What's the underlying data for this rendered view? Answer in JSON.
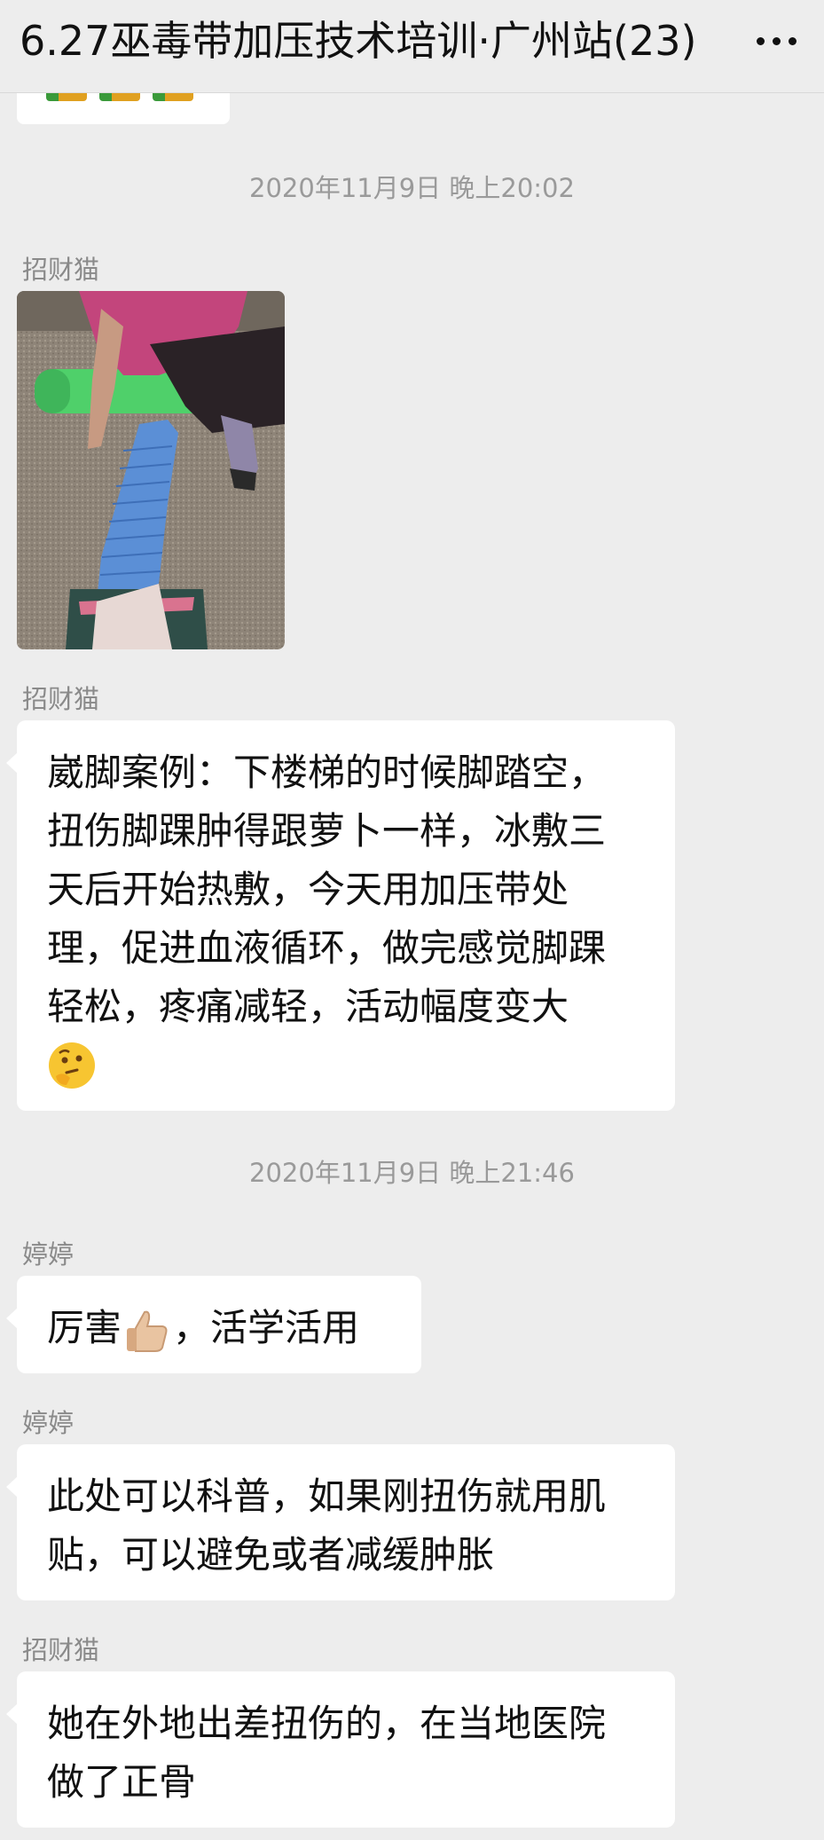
{
  "header": {
    "title": "6.27巫毒带加压技术培训·广州站(23)",
    "more_icon": "more-dots-icon"
  },
  "messages": {
    "ts1": "2020年11月9日 晚上20:02",
    "m1": {
      "sender": "招财猫"
    },
    "m2": {
      "sender": "招财猫",
      "lines": [
        "崴脚案例：下楼梯的时候脚踏空，",
        "扭伤脚踝肿得跟萝卜一样，冰敷三",
        "天后开始热敷，今天用加压带处",
        "理，促进血液循环，做完感觉脚踝",
        "轻松，疼痛减轻，活动幅度变大"
      ],
      "emoji": "thinking-face-icon"
    },
    "ts2": "2020年11月9日 晚上21:46",
    "m3": {
      "sender": "婷婷",
      "text_a": "厉害",
      "emoji": "thumbs-up-icon",
      "text_b": "，活学活用"
    },
    "m4": {
      "sender": "婷婷",
      "lines": [
        "此处可以科普，如果刚扭伤就用肌",
        "贴，可以避免或者减缓肿胀"
      ]
    },
    "m5": {
      "sender": "招财猫",
      "lines": [
        "她在外地出差扭伤的，在当地医院",
        "做了正骨"
      ]
    }
  },
  "colors": {
    "background": "#ededed",
    "bubble": "#ffffff",
    "meta_text": "#9a9a9a"
  }
}
